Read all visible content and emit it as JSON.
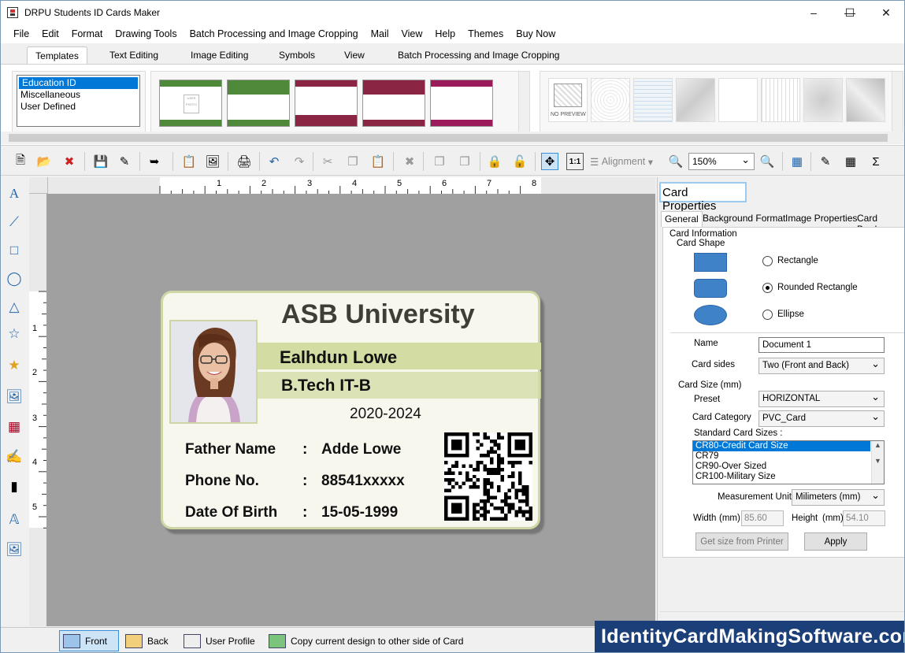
{
  "window": {
    "title": "DRPU Students ID Cards Maker"
  },
  "menu": [
    "File",
    "Edit",
    "Format",
    "Drawing Tools",
    "Batch Processing and Image Cropping",
    "Mail",
    "View",
    "Help",
    "Themes",
    "Buy Now"
  ],
  "ribbon_tabs": [
    "Templates",
    "Text Editing",
    "Image Editing",
    "Symbols",
    "View",
    "Batch Processing and Image Cropping"
  ],
  "categories": [
    "Education ID",
    "Miscellaneous",
    "User Defined"
  ],
  "bg_no_preview": "NO PREVIEW",
  "template_photo_text": "USER PHOTO",
  "toolbar": {
    "alignment_label": "Alignment",
    "zoom_value": "150%"
  },
  "ruler_h": [
    "1",
    "2",
    "3",
    "4",
    "5",
    "6",
    "7",
    "8"
  ],
  "ruler_v": [
    "1",
    "2",
    "3",
    "4",
    "5"
  ],
  "card": {
    "university": "ASB University",
    "name": "Ealhdun Lowe",
    "course": "B.Tech IT-B",
    "years": "2020-2024",
    "fields": [
      {
        "label": "Father Name",
        "colon": ":",
        "value": "Adde Lowe"
      },
      {
        "label": "Phone No.",
        "colon": ":",
        "value": "88541xxxxx"
      },
      {
        "label": "Date Of Birth",
        "colon": ":",
        "value": "15-05-1999"
      }
    ],
    "accent": "#d2dca3"
  },
  "panel": {
    "title": "Card Properties",
    "tabs": [
      "General",
      "Background Format",
      "Image Properties",
      "Card Border"
    ],
    "card_information": "Card Information",
    "card_shape": "Card Shape",
    "shapes": [
      "Rectangle",
      "Rounded Rectangle",
      "Ellipse"
    ],
    "selected_shape": "Rounded Rectangle",
    "name_label": "Name",
    "name_value": "Document 1",
    "sides_label": "Card sides",
    "sides_value": "Two (Front and Back)",
    "card_size": "Card Size (mm)",
    "preset_label": "Preset",
    "preset_value": "HORIZONTAL",
    "category_label": "Card Category",
    "category_value": "PVC_Card",
    "standard_sizes_label": "Standard Card Sizes :",
    "standard_sizes": [
      "CR80-Credit Card Size",
      "CR79",
      "CR90-Over Sized",
      "CR100-Military Size"
    ],
    "unit_label": "Measurement Unit :",
    "unit_value": "Milimeters (mm)",
    "width_label": "Width",
    "width_unit": "(mm)",
    "width_value": "85.60",
    "height_label": "Height",
    "height_unit": "(mm)",
    "height_value": "54.10",
    "printer_button": "Get size from Printer",
    "apply_button": "Apply"
  },
  "status": {
    "front": "Front",
    "back": "Back",
    "user_profile": "User Profile",
    "copy": "Copy current design to other side of Card"
  },
  "brand": "IdentityCardMakingSoftware.com"
}
